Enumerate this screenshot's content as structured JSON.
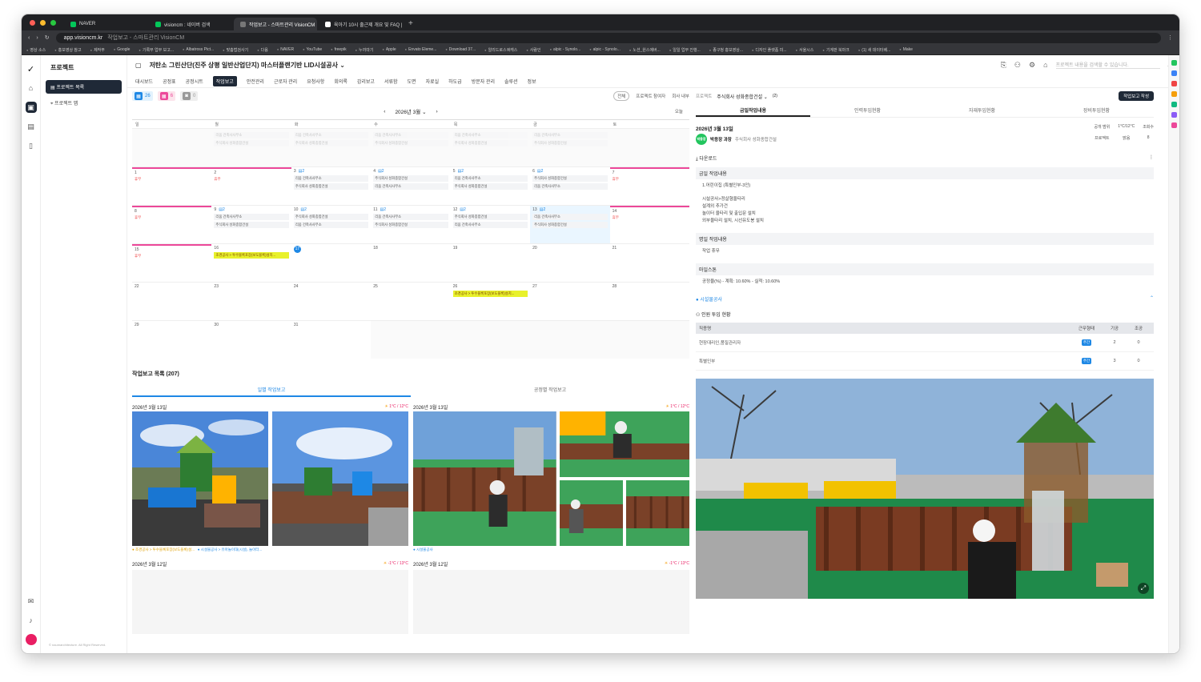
{
  "browser": {
    "tabs": [
      {
        "label": "NAVER",
        "color": "#03c75a"
      },
      {
        "label": "visioncm : 네이버 검색",
        "color": "#03c75a"
      },
      {
        "label": "작업보고 - 스마트관리 VisionCM",
        "color": "#777777"
      },
      {
        "label": "육아기 10시 출근제 개요 및 FAQ | ...",
        "color": "#ffffff"
      }
    ],
    "url": "app.visioncm.kr",
    "url_title": "작업보고 - 스마트관리 VisionCM",
    "bookmarks": [
      "영상 소스",
      "홍보영상 참고",
      "제작부",
      "Google",
      "기록부 업무 보고...",
      "Albatross Pict...",
      "맞춤법검사기",
      "다음",
      "NAVER",
      "YouTube",
      "freepik",
      "누끼따기",
      "Apple",
      "Envato Eleme...",
      "Download 37...",
      "알리드로스쿼캐스",
      "사람인",
      "alpic - Synolo...",
      "alpic - Synolo...",
      "노션_원스에버...",
      "일일 업무 진행...",
      "종구청 홍보영상...",
      "디자인 플랫폼 미...",
      "서울시스",
      "기계판 북마크",
      "(1) 새 데이터베...",
      "Make"
    ]
  },
  "sidebar": {
    "title": "프로젝트",
    "items": [
      {
        "label": "프로젝트 목록"
      },
      {
        "label": "프로젝트 맵"
      }
    ],
    "copyright": "© naumarchitecture. All Right Reserved."
  },
  "header": {
    "project_title": "저탄소 그린산단(진주 상평 일반산업단지) 마스터플랜기반 LID시설공사",
    "search_placeholder": "프로젝트 내용을 검색할 수 있습니다."
  },
  "menu": [
    "대시보드",
    "공정표",
    "공정시트",
    "작업보고",
    "안전관리",
    "근로자 관리",
    "요청사항",
    "회의록",
    "감리보고",
    "서류함",
    "도면",
    "자료실",
    "하도급",
    "방문자 관리",
    "솔루션",
    "정보"
  ],
  "menu_active": 3,
  "filters": {
    "blue_count": "26",
    "pink_count": "6",
    "gray_count": "0"
  },
  "view_toggle": {
    "all": "전체",
    "participants": "프로젝트 참여자",
    "internal": "회사 내부"
  },
  "calendar": {
    "month": "2026년 3월",
    "today_label": "오늘",
    "weekdays": [
      "일",
      "월",
      "화",
      "수",
      "목",
      "금",
      "토"
    ],
    "holiday_label": "휴무",
    "events": {
      "a": "리움 건축사사무소",
      "b": "주식회사 성화종합건설",
      "y16": "조경공사 > 투수블록포장(보도블록)설치...",
      "y26": "조경공사 > 투수블록포장(보도블록)설치..."
    },
    "days": [
      "1",
      "2",
      "3",
      "4",
      "5",
      "6",
      "7",
      "8",
      "9",
      "10",
      "11",
      "12",
      "13",
      "14",
      "15",
      "16",
      "17",
      "18",
      "19",
      "20",
      "21",
      "22",
      "23",
      "24",
      "25",
      "26",
      "27",
      "28",
      "29",
      "30",
      "31"
    ],
    "report_count": "2"
  },
  "report_list": {
    "title": "작업보고 목록 (207)",
    "tabs": [
      "일별 작업보고",
      "공정별 작업보고"
    ],
    "cards": [
      {
        "date": "2026년 3월 13일",
        "weather": "1°C / 12°C",
        "captions": [
          "● 조경공사 > 투수블록포장(보도블록)설...",
          "● 시설물공사 > 유아놀이대(시설), 놀이터..."
        ]
      },
      {
        "date": "2026년 3월 13일",
        "weather": "1°C / 12°C",
        "captions": [
          "● 시설물공사"
        ]
      },
      {
        "date": "2026년 3월 12일",
        "weather": "-1°C / 13°C"
      },
      {
        "date": "2026년 3월 12일",
        "weather": "-1°C / 13°C"
      }
    ]
  },
  "detail": {
    "project_label": "프로젝트",
    "company": "주식회사 성화종합건설",
    "count": "(2)",
    "write_btn": "작업보고 작성",
    "tabs": [
      "금일작업내용",
      "인력투입현황",
      "자재투입현황",
      "장비투입현황"
    ],
    "date": "2026년 3월 13일",
    "author_badge": "박용장",
    "author": "박용장 과장",
    "author_company": "주식회사 성화종합건설",
    "meta_labels": [
      "공개 범위",
      "1°C/12°C",
      "조회수"
    ],
    "meta_values": [
      "프로젝트",
      "맑음",
      "8"
    ],
    "download": "다운로드",
    "today_work_title": "금일 작업내용",
    "today_work_lines": [
      "1.어린이집 (특별인부-3인)",
      "",
      "시설공사>정살형울타리",
      "설계외 추가건",
      "놀이터 울타리 및 출입문 설치",
      "외부울타리 설치, 시선유도봉 설치"
    ],
    "tomorrow_title": "명일 작업내용",
    "tomorrow_text": "작업 휴무",
    "milestone_title": "마일스톤",
    "milestone_text": "공정율(%) - 계획: 10.60% - 실적: 10.60%",
    "facility_section": "● 시설물공사",
    "manpower_title": "인원 투입 현황",
    "table_head": [
      "직종명",
      "근무형태",
      "기공",
      "조공"
    ],
    "rows": [
      {
        "name": "현장대리인,품질관리자",
        "type": "주간",
        "a": "2",
        "b": "0"
      },
      {
        "name": "특별인부",
        "type": "주간",
        "a": "3",
        "b": "0"
      }
    ]
  },
  "colors": {
    "accent": "#1e88e5",
    "dark": "#1f2937",
    "holiday": "#ec4899",
    "event_yellow": "#e8f12b"
  }
}
